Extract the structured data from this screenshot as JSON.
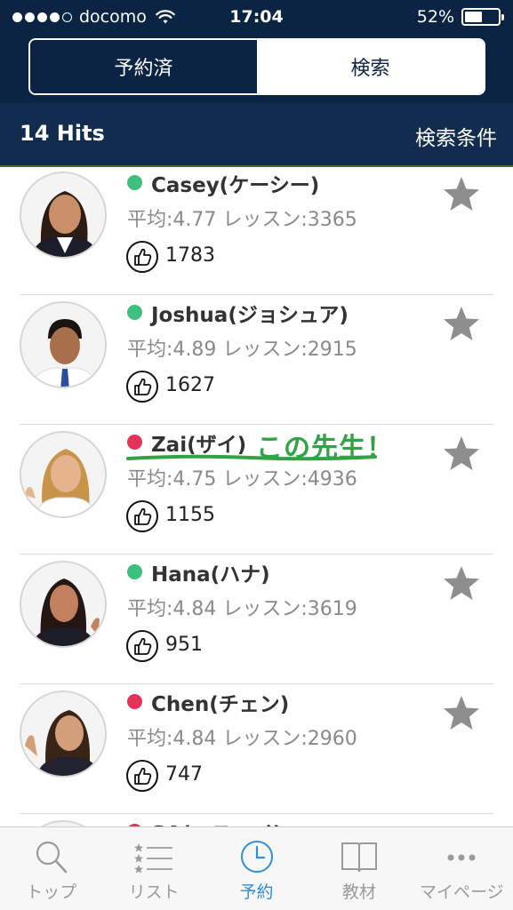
{
  "status_bar": {
    "carrier": "docomo",
    "time": "17:04",
    "battery": "52%",
    "battery_level": 0.52
  },
  "segment": {
    "reserved_label": "予約済",
    "search_label": "検索",
    "active": "search"
  },
  "hits": {
    "count_label": "14 Hits",
    "conditions_label": "検索条件"
  },
  "teachers": [
    {
      "name": "Casey(ケーシー)",
      "stats": "平均:4.77 レッスン:3365",
      "likes": "1783",
      "status": "online"
    },
    {
      "name": "Joshua(ジョシュア)",
      "stats": "平均:4.89 レッスン:2915",
      "likes": "1627",
      "status": "online"
    },
    {
      "name": "Zai(ザイ)",
      "stats": "平均:4.75 レッスン:4936",
      "likes": "1155",
      "status": "offline"
    },
    {
      "name": "Hana(ハナ)",
      "stats": "平均:4.84 レッスン:3619",
      "likes": "951",
      "status": "online"
    },
    {
      "name": "Chen(チェン)",
      "stats": "平均:4.84 レッスン:2960",
      "likes": "747",
      "status": "offline"
    },
    {
      "name": "SA(エスエイ)",
      "stats": "",
      "likes": "",
      "status": "offline"
    }
  ],
  "annotation": {
    "text": "この先生！"
  },
  "tabs": [
    {
      "label": "トップ",
      "icon": "search-icon"
    },
    {
      "label": "リスト",
      "icon": "list-icon"
    },
    {
      "label": "予約",
      "icon": "clock-icon",
      "active": true
    },
    {
      "label": "教材",
      "icon": "book-icon"
    },
    {
      "label": "マイページ",
      "icon": "more-icon"
    }
  ],
  "colors": {
    "header_bg": "#0b2444",
    "subheader_bg": "#112c4f",
    "online": "#3dbf7d",
    "offline": "#e5325a",
    "star": "#8e8e8e",
    "annotation": "#31a345",
    "tab_active": "#2f8fd8",
    "tab_inactive": "#9a9a9a"
  }
}
